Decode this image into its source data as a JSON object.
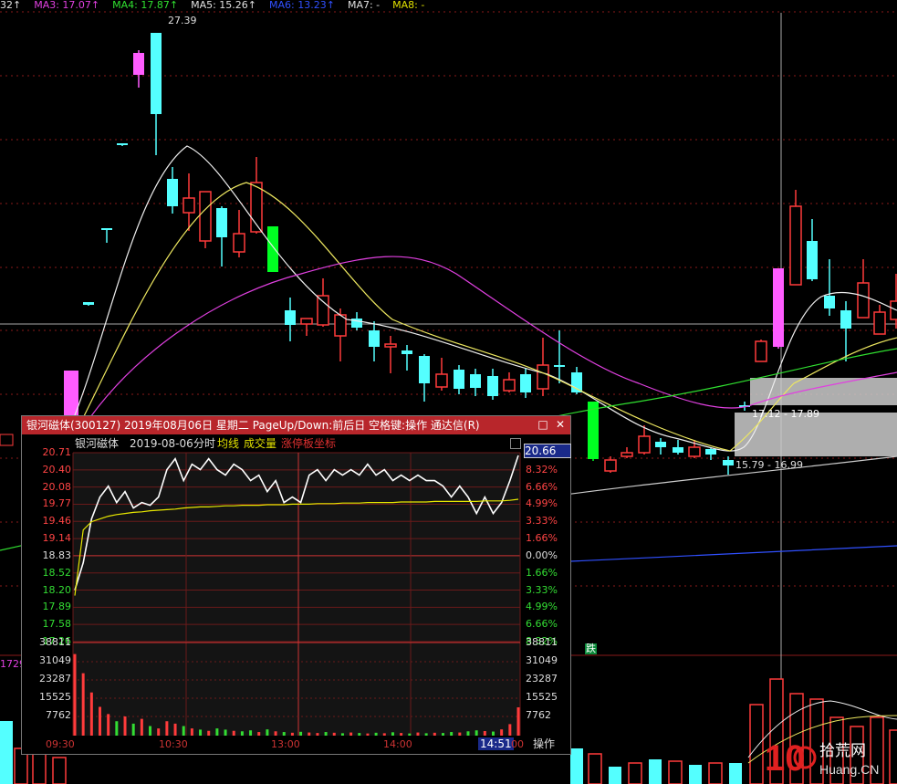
{
  "ma_indicators": [
    {
      "label": "32↑",
      "color": "#e0e0e0"
    },
    {
      "label": "MA3: 17.07↑",
      "color": "#e040e0"
    },
    {
      "label": "MA4: 17.87↑",
      "color": "#30e030"
    },
    {
      "label": "MA5: 15.26↑",
      "color": "#e0e0e0"
    },
    {
      "label": "MA6: 13.23↑",
      "color": "#3050ff"
    },
    {
      "label": "MA7: -",
      "color": "#e0e0e0"
    },
    {
      "label": "MA8: -",
      "color": "#e0e000"
    }
  ],
  "main_chart": {
    "high_label": "27.39",
    "low_label": "15.79 - 16.99",
    "range_label": "17.12 - 17.89",
    "fall_badge": "跌",
    "left_volume_label": "1729"
  },
  "popup": {
    "title": "银河磁体(300127) 2019年08月06日 星期二 PageUp/Down:前后日 空格键:操作 通达信(R)",
    "restore_icon": "□",
    "close_icon": "✕",
    "stock_name": "银河磁体",
    "date": "2019-08-06",
    "mode": "分时",
    "avg_label": "均线",
    "vol_label": "成交量",
    "limit_label": "涨停板坐标",
    "current_price": "20.66",
    "price_labels": [
      "20.71",
      "20.40",
      "20.08",
      "19.77",
      "19.46",
      "19.14",
      "18.83",
      "18.52",
      "18.20",
      "17.89",
      "17.58",
      "17.26"
    ],
    "pct_labels": [
      "8.32%",
      "6.66%",
      "4.99%",
      "3.33%",
      "1.66%",
      "0.00%",
      "1.66%",
      "3.33%",
      "4.99%",
      "6.66%",
      "8.32%"
    ],
    "vol_labels": [
      "38811",
      "31049",
      "23287",
      "15525",
      "7762"
    ],
    "time_labels": [
      "09:30",
      "10:30",
      "13:00",
      "14:00"
    ],
    "cursor_time": "14:51",
    "cursor_suffix": "00",
    "operate_label": "操作"
  },
  "chart_data": {
    "type": "line",
    "title": "银河磁体(300127) 2019-08-06 分时",
    "prev_close": 18.83,
    "ylim": [
      17.26,
      20.71
    ],
    "volume_ylim": [
      0,
      38811
    ],
    "series": [
      {
        "name": "分时",
        "values": [
          18.2,
          18.7,
          19.5,
          19.9,
          20.1,
          19.8,
          20.0,
          19.7,
          19.8,
          19.75,
          19.9,
          20.4,
          20.6,
          20.2,
          20.5,
          20.4,
          20.6,
          20.4,
          20.3,
          20.5,
          20.4,
          20.2,
          20.3,
          20.0,
          20.2,
          19.8,
          19.9,
          19.8,
          20.3,
          20.4,
          20.2,
          20.4,
          20.3,
          20.4,
          20.3,
          20.5,
          20.3,
          20.4,
          20.2,
          20.3,
          20.2,
          20.3,
          20.2,
          20.2,
          20.1,
          19.9,
          20.1,
          19.9,
          19.6,
          19.9,
          19.6,
          19.8,
          20.2,
          20.66
        ]
      },
      {
        "name": "均线",
        "values": [
          18.1,
          19.3,
          19.45,
          19.5,
          19.55,
          19.58,
          19.6,
          19.62,
          19.63,
          19.65,
          19.66,
          19.67,
          19.68,
          19.7,
          19.71,
          19.72,
          19.72,
          19.73,
          19.74,
          19.74,
          19.75,
          19.75,
          19.75,
          19.76,
          19.76,
          19.76,
          19.77,
          19.77,
          19.77,
          19.78,
          19.78,
          19.78,
          19.79,
          19.79,
          19.79,
          19.8,
          19.8,
          19.8,
          19.8,
          19.81,
          19.81,
          19.81,
          19.81,
          19.82,
          19.82,
          19.82,
          19.82,
          19.82,
          19.82,
          19.83,
          19.83,
          19.83,
          19.84,
          19.86
        ]
      }
    ],
    "volume": [
      34000,
      26000,
      18000,
      12000,
      9000,
      6000,
      8000,
      5000,
      7000,
      4000,
      3000,
      6000,
      5000,
      4000,
      3000,
      2500,
      2000,
      3000,
      2500,
      2000,
      1800,
      2200,
      1500,
      2600,
      1800,
      1500,
      1200,
      1600,
      1300,
      1100,
      1500,
      1200,
      1000,
      1300,
      1100,
      900,
      1200,
      1000,
      1400,
      1100,
      900,
      1300,
      1000,
      1200,
      1100,
      1500,
      1300,
      1800,
      2200,
      1900,
      1700,
      2600,
      4800,
      11800
    ]
  }
}
